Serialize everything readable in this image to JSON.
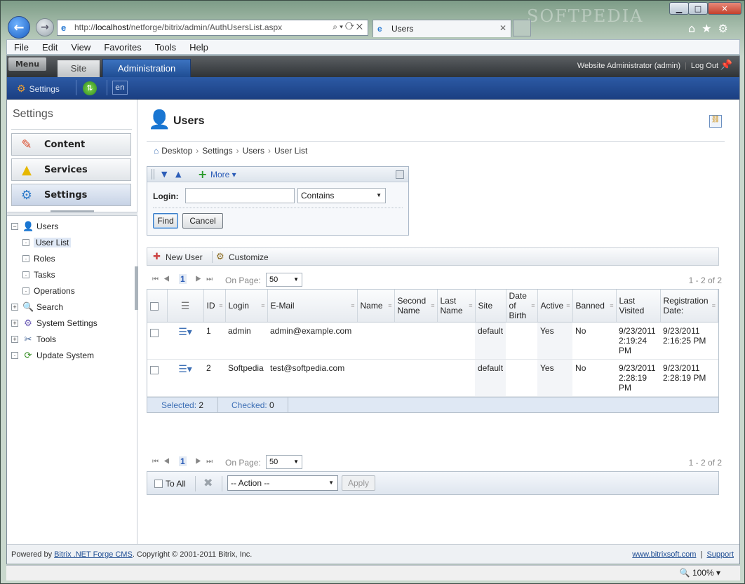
{
  "browser": {
    "address_prefix": "http://",
    "address_host": "localhost",
    "address_path": "/netforge/bitrix/admin/AuthUsersList.aspx",
    "tab_title": "Users",
    "menu": [
      "File",
      "Edit",
      "View",
      "Favorites",
      "Tools",
      "Help"
    ],
    "zoom": "100%",
    "watermark": "SOFTPEDIA"
  },
  "adminbar": {
    "menu_label": "Menu",
    "site_tab": "Site",
    "admin_tab": "Administration",
    "user": "Website Administrator (admin)",
    "logout": "Log Out",
    "settings_label": "Settings",
    "lang": "en"
  },
  "sidebar": {
    "title": "Settings",
    "buttons": [
      {
        "label": "Content"
      },
      {
        "label": "Services"
      },
      {
        "label": "Settings"
      }
    ],
    "tree": [
      {
        "label": "Users",
        "expanded": true
      },
      {
        "label": "User List"
      },
      {
        "label": "Roles"
      },
      {
        "label": "Tasks"
      },
      {
        "label": "Operations"
      },
      {
        "label": "Search"
      },
      {
        "label": "System Settings"
      },
      {
        "label": "Tools"
      },
      {
        "label": "Update System"
      }
    ]
  },
  "page": {
    "title": "Users",
    "breadcrumb": [
      "Desktop",
      "Settings",
      "Users",
      "User List"
    ]
  },
  "filter": {
    "more_label": "More",
    "login_label": "Login:",
    "login_value": "",
    "condition": "Contains",
    "find_label": "Find",
    "cancel_label": "Cancel"
  },
  "context": {
    "new_user": "New User",
    "customize": "Customize"
  },
  "pager": {
    "page": "1",
    "on_page_label": "On Page:",
    "page_size": "50",
    "total": "1 - 2 of 2"
  },
  "grid": {
    "columns": [
      "ID",
      "Login",
      "E-Mail",
      "Name",
      "Second Name",
      "Last Name",
      "Site",
      "Date of Birth",
      "Active",
      "Banned",
      "Last Visited",
      "Registration Date:"
    ],
    "rows": [
      {
        "id": "1",
        "login": "admin",
        "email": "admin@example.com",
        "name": "",
        "second_name": "",
        "last_name": "",
        "site": "default",
        "dob": "",
        "active": "Yes",
        "banned": "No",
        "last_visited": "9/23/2011 2:19:24 PM",
        "registered": "9/23/2011 2:16:25 PM"
      },
      {
        "id": "2",
        "login": "Softpedia",
        "email": "test@softpedia.com",
        "name": "",
        "second_name": "",
        "last_name": "",
        "site": "default",
        "dob": "",
        "active": "Yes",
        "banned": "No",
        "last_visited": "9/23/2011 2:28:19 PM",
        "registered": "9/23/2011 2:28:19 PM"
      }
    ],
    "selected_label": "Selected:",
    "selected_value": "2",
    "checked_label": "Checked:",
    "checked_value": "0"
  },
  "actions": {
    "to_all": "To All",
    "action_select": "-- Action --",
    "apply": "Apply"
  },
  "footer": {
    "powered_prefix": "Powered by ",
    "powered_link": "Bitrix .NET Forge CMS",
    "copyright": ". Copyright © 2001-2011 Bitrix, Inc.",
    "site_link": "www.bitrixsoft.com",
    "support": "Support"
  }
}
